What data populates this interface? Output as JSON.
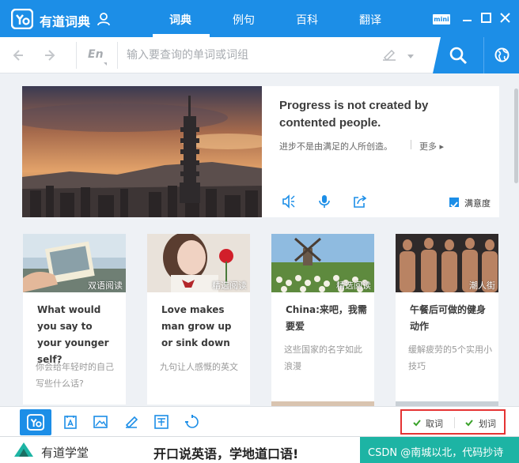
{
  "app": {
    "title": "有道词典"
  },
  "nav": {
    "tabs": [
      "词典",
      "例句",
      "百科",
      "翻译"
    ],
    "active": 0
  },
  "window": {
    "mini_label": "mini"
  },
  "search": {
    "lang": "En",
    "placeholder": "输入要查询的单词或词组"
  },
  "hero": {
    "quote": "Progress is not created by contented people.",
    "translation": "进步不是由满足的人所创造。",
    "more_label": "更多",
    "satisfaction_label": "满意度"
  },
  "cards": [
    {
      "tag": "双语阅读",
      "title": "What would you say to your younger self?",
      "desc": "你会给年轻时的自己写些什么话?"
    },
    {
      "tag": "精选阅读",
      "title": "Love makes man grow up or sink down",
      "desc": "九句让人感慨的英文"
    },
    {
      "tag": "精选阅读",
      "title": "China:来吧，我需要爱",
      "desc": "这些国家的名字如此浪漫"
    },
    {
      "tag": "潮人街",
      "title": "午餐后可做的健身动作",
      "desc": "缓解疲劳的5个实用小技巧"
    }
  ],
  "toolbar": {
    "fetch_label": "取词",
    "select_label": "划词"
  },
  "ad": {
    "brand": "有道学堂",
    "slogan": "开口说英语，学地道口语!",
    "watermark": "CSDN @南城以北，代码抄诗"
  },
  "colors": {
    "accent": "#1c8ee7",
    "highlight_border": "#e53333",
    "ad_green": "#1db4a4"
  }
}
